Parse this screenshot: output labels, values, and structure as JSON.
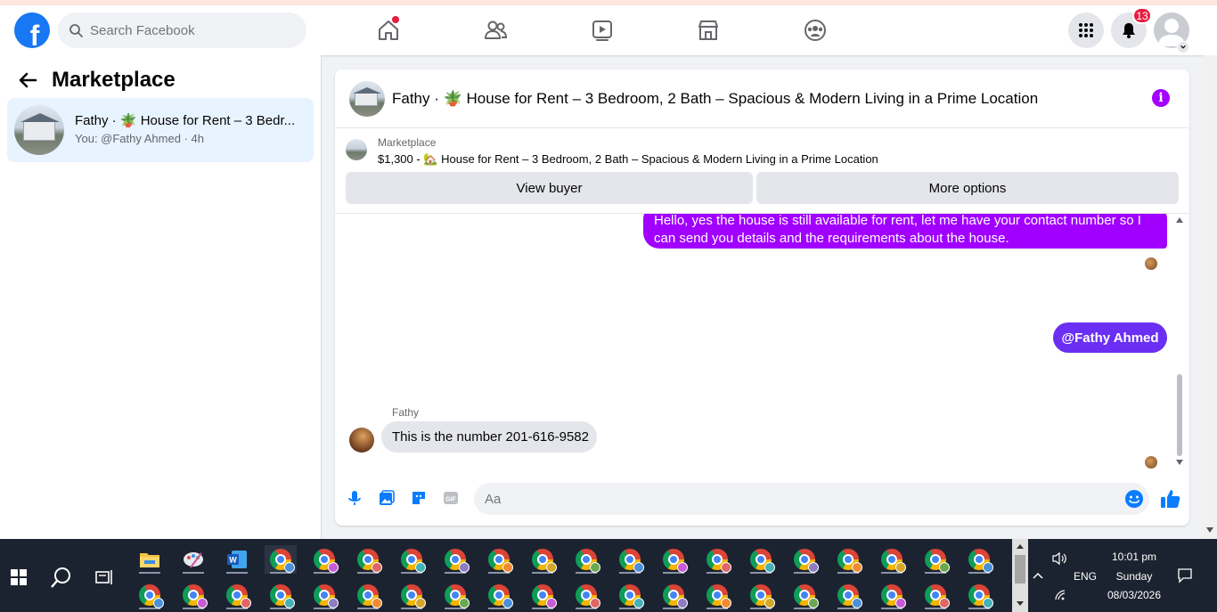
{
  "topbar": {
    "logo_letter": "f",
    "search_placeholder": "Search Facebook",
    "notifications_count": "13",
    "colors": {
      "brand": "#1877f2",
      "badge": "#e41e3f"
    }
  },
  "sidebar": {
    "title": "Marketplace",
    "conversation": {
      "name": "Fathy · 🪴 House for Rent – 3 Bedr...",
      "subtitle": "You: @Fathy Ahmed · 4h"
    }
  },
  "chat": {
    "header_title": "Fathy · 🪴 House for Rent – 3 Bedroom, 2 Bath – Spacious & Modern Living in a Prime Location",
    "listing": {
      "label": "Marketplace",
      "text": "$1,300 - 🏡 House for Rent – 3 Bedroom, 2 Bath – Spacious & Modern Living in a Prime Location",
      "view_buyer": "View buyer",
      "more_options": "More options"
    },
    "messages": {
      "outgoing_text": "Hello, yes the house is still available for rent, let me have your contact number so I can send you details and the requirements about the house.",
      "mention": "@Fathy Ahmed",
      "sender_name": "Fathy",
      "incoming_text": "This is the number 201-616-9582"
    },
    "composer": {
      "placeholder": "Aa"
    },
    "colors": {
      "outgoing_bubble": "#a100ff",
      "mention_bubble": "#6a2ff2",
      "info_icon": "#a100ff"
    }
  },
  "taskbar": {
    "language": "ENG",
    "time": "10:01 pm",
    "day": "Sunday",
    "date": "08/03/2026"
  }
}
